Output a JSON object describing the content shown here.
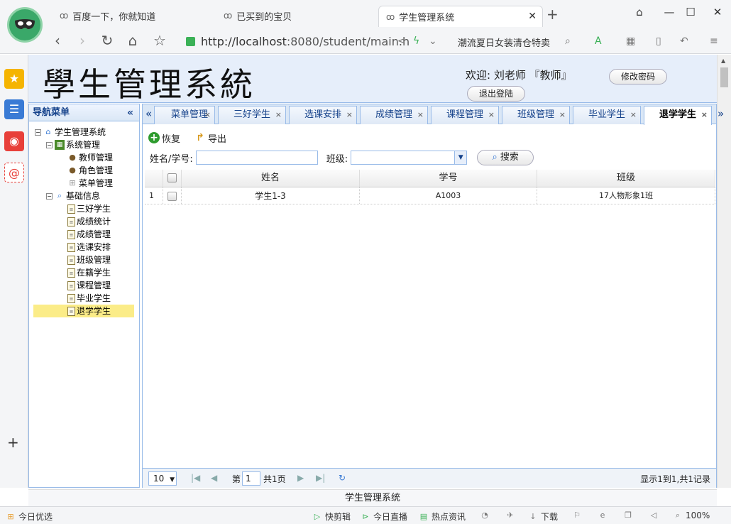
{
  "browser": {
    "tabs": [
      {
        "label": "百度一下，你就知道"
      },
      {
        "label": "已买到的宝贝"
      },
      {
        "label": "学生管理系统",
        "active": true
      }
    ],
    "url_host": "http://localhost",
    "url_path": ":8080/student/main.h",
    "promo_text": "潮流夏日女装清仓特卖",
    "status_title": "学生管理系统",
    "bottom_left": "今日优选",
    "bottom_items": [
      "快剪辑",
      "今日直播",
      "热点资讯"
    ],
    "download_label": "下载",
    "zoom": "100%"
  },
  "header": {
    "title": "學生管理系統",
    "welcome": "欢迎: 刘老师 『教师』",
    "change_password": "修改密码",
    "logout": "退出登陆"
  },
  "nav": {
    "title": "导航菜单",
    "root": "学生管理系统",
    "groups": [
      {
        "label": "系统管理",
        "items": [
          "教师管理",
          "角色管理",
          "菜单管理"
        ]
      },
      {
        "label": "基础信息",
        "items": [
          "三好学生",
          "成绩统计",
          "成绩管理",
          "选课安排",
          "班级管理",
          "在籍学生",
          "课程管理",
          "毕业学生",
          "退学学生"
        ]
      }
    ],
    "selected": "退学学生"
  },
  "tabs": [
    "菜单管理",
    "三好学生",
    "选课安排",
    "成绩管理",
    "课程管理",
    "班级管理",
    "毕业学生",
    "退学学生"
  ],
  "active_tab": "退学学生",
  "toolbar": {
    "restore": "恢复",
    "export": "导出"
  },
  "search": {
    "name_label": "姓名/学号:",
    "name_value": "",
    "class_label": "班级:",
    "class_value": "",
    "button": "搜索"
  },
  "grid": {
    "columns": [
      "姓名",
      "学号",
      "班级"
    ],
    "rows": [
      {
        "num": "1",
        "name": "学生1-3",
        "sno": "A1003",
        "class": "17人物形象1班"
      }
    ]
  },
  "pager": {
    "page_size": "10",
    "page_prefix": "第",
    "page_number": "1",
    "page_total": "共1页",
    "info": "显示1到1,共1记录"
  }
}
